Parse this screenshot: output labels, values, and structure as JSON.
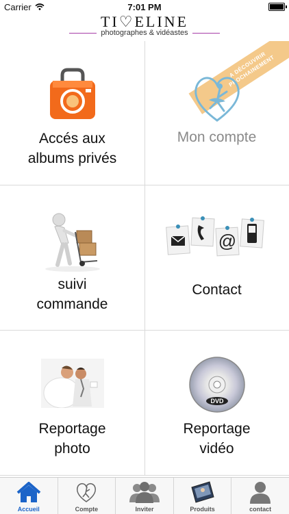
{
  "status": {
    "carrier": "Carrier",
    "time": "7:01 PM"
  },
  "header": {
    "brand": "TI♡ELINE",
    "tagline": "photographes & vidéastes"
  },
  "ribbon": {
    "line1": "A DÉCOUVRIR",
    "line2": "PROCHAINEMENT"
  },
  "cells": [
    {
      "label": "Accés aux\nalbums privés"
    },
    {
      "label": "Mon compte"
    },
    {
      "label": "suivi\ncommande"
    },
    {
      "label": "Contact"
    },
    {
      "label": "Reportage\nphoto"
    },
    {
      "label": "Reportage\nvidéo"
    }
  ],
  "dvd_text": "DVD",
  "tabs": [
    {
      "label": "Accueil"
    },
    {
      "label": "Compte"
    },
    {
      "label": "Inviter"
    },
    {
      "label": "Produits"
    },
    {
      "label": "contact"
    }
  ],
  "colors": {
    "accent": "#1c64c8",
    "camera": "#f26a1b",
    "dancer": "#7ab8d8",
    "ribbon": "#f4c98a"
  }
}
